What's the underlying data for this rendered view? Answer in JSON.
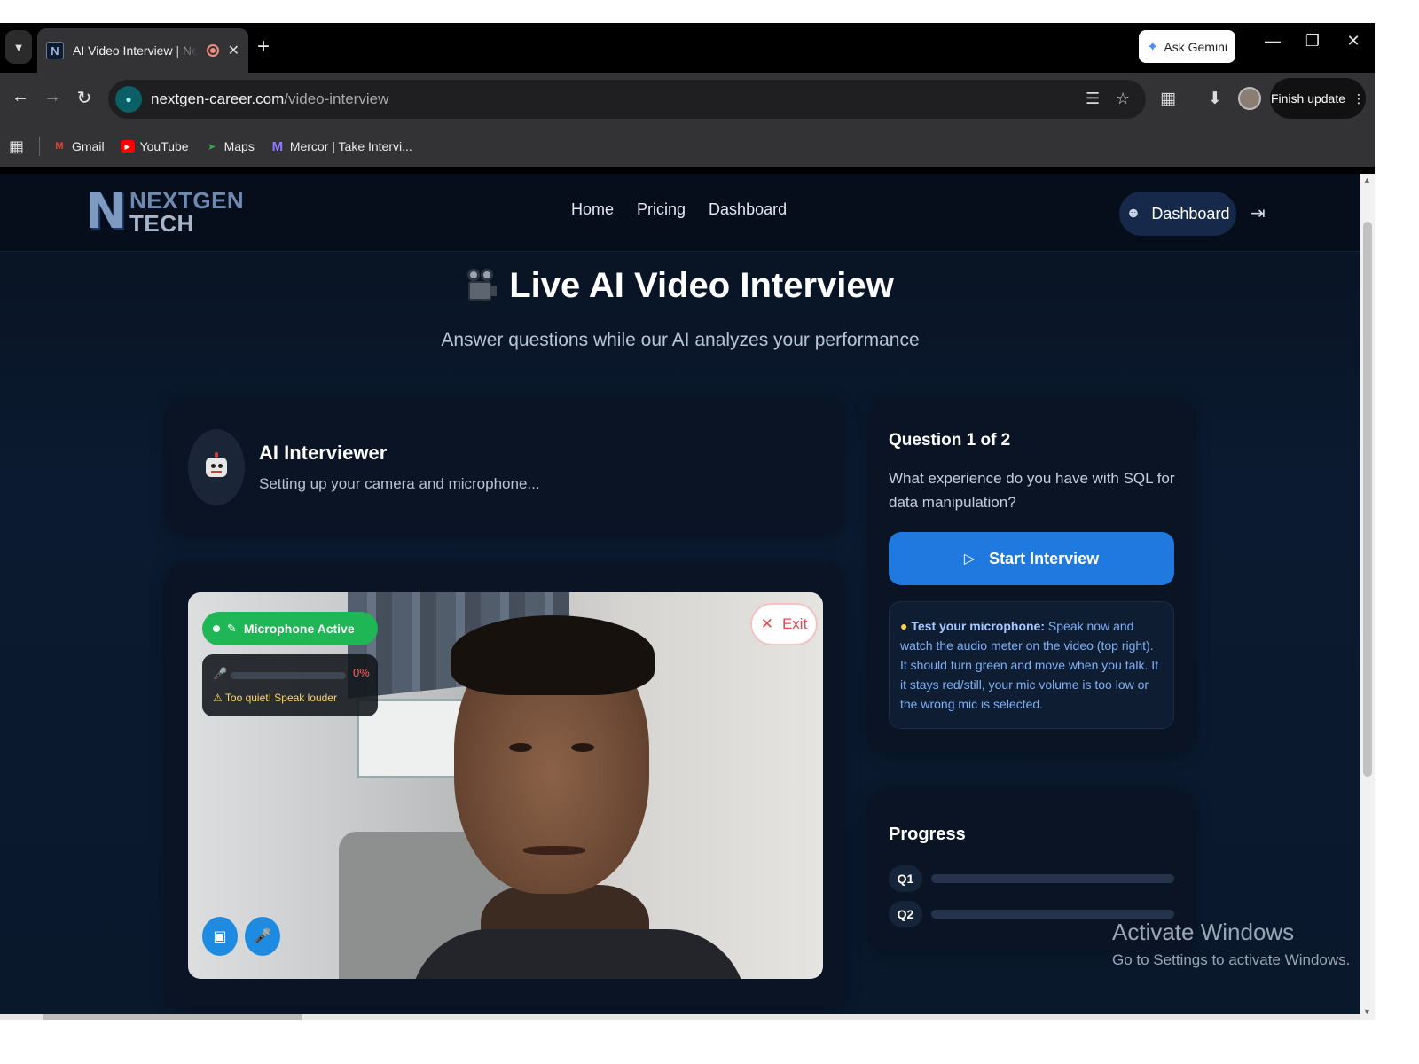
{
  "browser": {
    "tab_title": "AI Video Interview | NextGen Tech",
    "new_tab_symbol": "+",
    "ask_gemini": "Ask Gemini",
    "url_domain": "nextgen-career.com",
    "url_path": "/video-interview",
    "finish_update": "Finish update",
    "bookmarks": [
      {
        "label": "Gmail",
        "icon": "gmail-icon"
      },
      {
        "label": "YouTube",
        "icon": "youtube-icon"
      },
      {
        "label": "Maps",
        "icon": "maps-icon"
      },
      {
        "label": "Mercor | Take Intervi...",
        "icon": "mercor-icon"
      }
    ]
  },
  "site": {
    "logo_line1": "NEXTGEN",
    "logo_line2": "TECH",
    "nav": [
      "Home",
      "Pricing",
      "Dashboard"
    ],
    "dashboard_button": "Dashboard"
  },
  "hero": {
    "title": "Live AI Video Interview",
    "subtitle": "Answer questions while our AI analyzes your performance"
  },
  "interviewer": {
    "name": "AI Interviewer",
    "status": "Setting up your camera and microphone..."
  },
  "video": {
    "mic_status": "Microphone Active",
    "mic_level_percent": 0,
    "mic_level_label": "0%",
    "mic_warning": "Too quiet! Speak louder",
    "exit_label": "Exit"
  },
  "question": {
    "counter": "Question 1 of 2",
    "text": "What experience do you have with SQL for data manipulation?",
    "start_button": "Start Interview",
    "tip_label": "Test your microphone:",
    "tip_text": "Speak now and watch the audio meter on the video (top right). It should turn green and move when you talk. If it stays red/still, your mic volume is too low or the wrong mic is selected."
  },
  "progress": {
    "title": "Progress",
    "items": [
      {
        "label": "Q1",
        "fraction": 0
      },
      {
        "label": "Q2",
        "fraction": 0
      }
    ]
  },
  "watermark": {
    "line1": "Activate Windows",
    "line2": "Go to Settings to activate Windows."
  },
  "colors": {
    "page_bg": "#0b1a30",
    "accent_blue": "#1f79de",
    "mic_active_green": "#1fb655",
    "meter_red": "#ff5a4e",
    "exit_red": "#e34b4b"
  }
}
